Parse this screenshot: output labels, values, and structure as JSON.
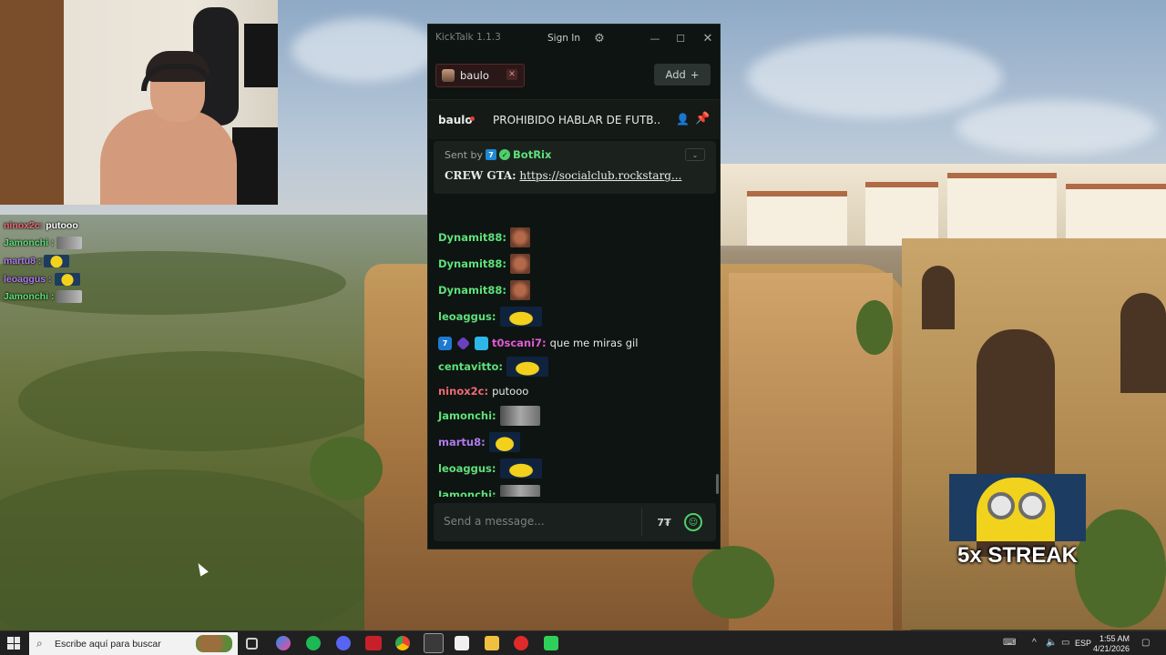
{
  "overlay_chat": [
    {
      "user": "ninox2c:",
      "color": "#ef6a78",
      "text": "putooo",
      "emote": null
    },
    {
      "user": "Jamonchi :",
      "color": "#5ee07a",
      "text": "",
      "emote": "photo"
    },
    {
      "user": "martu8 :",
      "color": "#b07af0",
      "text": "",
      "emote": "minion"
    },
    {
      "user": "leoaggus :",
      "color": "#b07af0",
      "text": "",
      "emote": "minion"
    },
    {
      "user": "Jamonchi :",
      "color": "#5ee07a",
      "text": "",
      "emote": "photo"
    }
  ],
  "streak": {
    "text": "5x STREAK"
  },
  "kicktalk": {
    "app_title": "KickTalk 1.1.3",
    "sign_in": "Sign In",
    "tab": {
      "label": "baulo"
    },
    "add_label": "Add",
    "channel_header": {
      "name": "baulo",
      "title": "PROHIBIDO HABLAR DE FUTB..."
    },
    "pinned": {
      "sent_by": "Sent by",
      "bot_name": "BotRix",
      "message_label": "CREW GTA:",
      "message_link": "https://socialclub.rockstarg..."
    },
    "messages": [
      {
        "user": "Dynamit88:",
        "color": "#5ee07a",
        "text": "",
        "emote": "face",
        "badges": []
      },
      {
        "user": "Dynamit88:",
        "color": "#5ee07a",
        "text": "",
        "emote": "face",
        "badges": []
      },
      {
        "user": "Dynamit88:",
        "color": "#5ee07a",
        "text": "",
        "emote": "face",
        "badges": []
      },
      {
        "user": "leoaggus:",
        "color": "#5ee07a",
        "text": "",
        "emote": "minion",
        "badges": []
      },
      {
        "user": "t0scani7:",
        "color": "#e25ad6",
        "text": "que me miras gil",
        "emote": null,
        "badges": [
          "kick",
          "gem",
          "sub"
        ]
      },
      {
        "user": "centavitto:",
        "color": "#5ee07a",
        "text": "",
        "emote": "minion",
        "badges": []
      },
      {
        "user": "ninox2c:",
        "color": "#ef6a78",
        "text": "putooo",
        "emote": null,
        "badges": []
      },
      {
        "user": "Jamonchi:",
        "color": "#5ee07a",
        "text": "",
        "emote": "photo",
        "badges": []
      },
      {
        "user": "martu8:",
        "color": "#b07af0",
        "text": "",
        "emote": "slim",
        "badges": []
      },
      {
        "user": "leoaggus:",
        "color": "#5ee07a",
        "text": "",
        "emote": "minion",
        "badges": []
      },
      {
        "user": "Jamonchi:",
        "color": "#5ee07a",
        "text": "",
        "emote": "photo",
        "badges": []
      }
    ],
    "input_placeholder": "Send a message..."
  },
  "taskbar": {
    "search_placeholder": "Escribe aquí para buscar",
    "language": "ESP",
    "time": "1:55 AM",
    "date": "4/21/2026"
  }
}
